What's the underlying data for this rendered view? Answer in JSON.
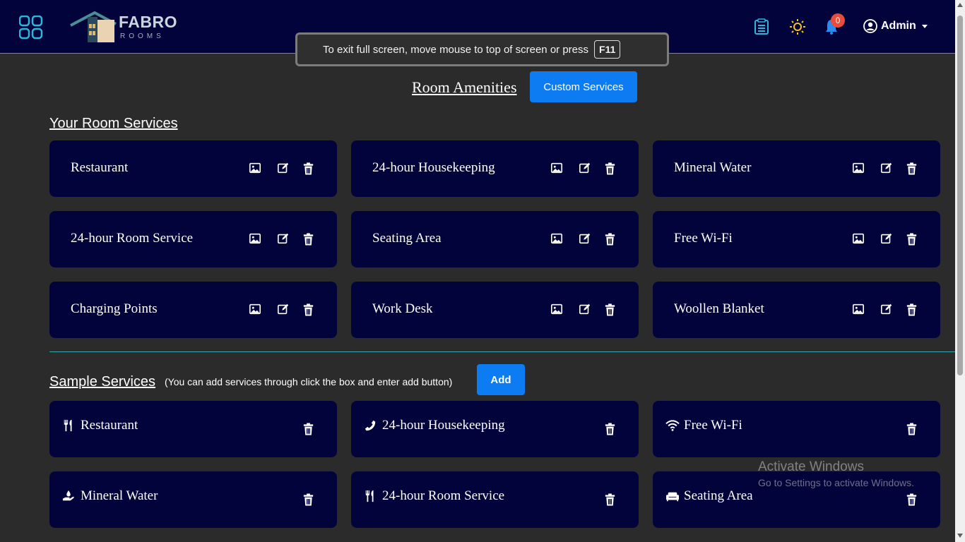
{
  "navbar": {
    "logo_text": "FABRO",
    "logo_sub": "ROOMS",
    "notification_count": "0",
    "user_label": "Admin"
  },
  "fullscreen_toast": {
    "message": "To exit full screen, move mouse to top of screen or press",
    "key": "F11"
  },
  "page": {
    "title": "Room Amenities",
    "custom_button": "Custom Services"
  },
  "your_services": {
    "title": "Your Room Services",
    "items": [
      "Restaurant",
      "24-hour Housekeeping",
      "Mineral Water",
      "24-hour Room Service",
      "Seating Area",
      "Free Wi-Fi",
      "Charging Points",
      "Work Desk",
      "Woollen Blanket"
    ]
  },
  "sample_services": {
    "title": "Sample Services",
    "hint": "(You can add services through click the box and enter add button)",
    "add_button": "Add",
    "items": [
      {
        "label": "Restaurant",
        "icon": "utensils-icon"
      },
      {
        "label": "24-hour Housekeeping",
        "icon": "phone-icon"
      },
      {
        "label": "Free Wi-Fi",
        "icon": "wifi-icon"
      },
      {
        "label": "Mineral Water",
        "icon": "hand-drop-icon"
      },
      {
        "label": "24-hour Room Service",
        "icon": "utensils-icon"
      },
      {
        "label": "Seating Area",
        "icon": "sofa-icon"
      }
    ]
  },
  "watermark": {
    "line1": "Activate Windows",
    "line2": "Go to Settings to activate Windows."
  },
  "colors": {
    "background": "#2b2b2b",
    "navbar": "#02033a",
    "card": "#02033a",
    "accent": "#0d7cf2",
    "divider": "#3aa6b0",
    "badge": "#e74c3c"
  }
}
